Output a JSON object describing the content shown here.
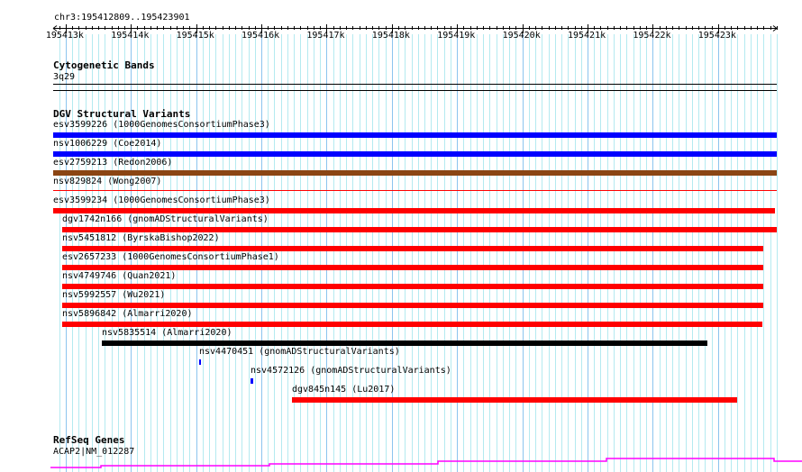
{
  "location": "chr3:195412809..195423901",
  "ruler": {
    "start": 195412809,
    "end": 195423901,
    "ticks": [
      "195413k",
      "195414k",
      "195415k",
      "195416k",
      "195417k",
      "195418k",
      "195419k",
      "195420k",
      "195421k",
      "195422k",
      "195423k"
    ]
  },
  "cytobands": {
    "title": "Cytogenetic Bands",
    "band": "3q29"
  },
  "dgv": {
    "title": "DGV Structural Variants",
    "variants": [
      {
        "label": "esv3599226 (1000GenomesConsortiumPhase3)",
        "start": 195412809,
        "end": 195423901,
        "color": "#0000ff"
      },
      {
        "label": "nsv1006229 (Coe2014)",
        "start": 195412809,
        "end": 195423901,
        "color": "#0000ff"
      },
      {
        "label": "esv2759213 (Redon2006)",
        "start": 195412809,
        "end": 195423901,
        "color": "#8b4513"
      },
      {
        "label": "nsv829824 (Wong2007)",
        "start": 195412809,
        "end": 195423901,
        "color": "#ff0000",
        "thin": true
      },
      {
        "label": "esv3599234 (1000GenomesConsortiumPhase3)",
        "start": 195412809,
        "end": 195423880,
        "color": "#ff0000"
      },
      {
        "label": "dgv1742n166 (gnomADStructuralVariants)",
        "start": 195412950,
        "end": 195423901,
        "color": "#ff0000"
      },
      {
        "label": "nsv5451812 (ByrskaBishop2022)",
        "start": 195412950,
        "end": 195423690,
        "color": "#ff0000"
      },
      {
        "label": "esv2657233 (1000GenomesConsortiumPhase1)",
        "start": 195412950,
        "end": 195423690,
        "color": "#ff0000"
      },
      {
        "label": "nsv4749746 (Quan2021)",
        "start": 195412950,
        "end": 195423700,
        "color": "#ff0000"
      },
      {
        "label": "nsv5992557 (Wu2021)",
        "start": 195412950,
        "end": 195423690,
        "color": "#ff0000"
      },
      {
        "label": "nsv5896842 (Almarri2020)",
        "start": 195412950,
        "end": 195423680,
        "color": "#ff0000"
      },
      {
        "label": "nsv5835514 (Almarri2020)",
        "start": 195413560,
        "end": 195422840,
        "color": "#000000"
      },
      {
        "label": "nsv4470451 (gnomADStructuralVariants)",
        "start": 195415050,
        "end": 195415080,
        "color": "#0000ff"
      },
      {
        "label": "nsv4572126 (gnomADStructuralVariants)",
        "start": 195415840,
        "end": 195415870,
        "color": "#0000ff"
      },
      {
        "label": "dgv845n145 (Lu2017)",
        "start": 195416470,
        "end": 195423290,
        "color": "#ff0000"
      }
    ]
  },
  "refseq": {
    "title": "RefSeq Genes",
    "gene": "ACAP2|NM_012287",
    "color": "#ff00ff"
  }
}
